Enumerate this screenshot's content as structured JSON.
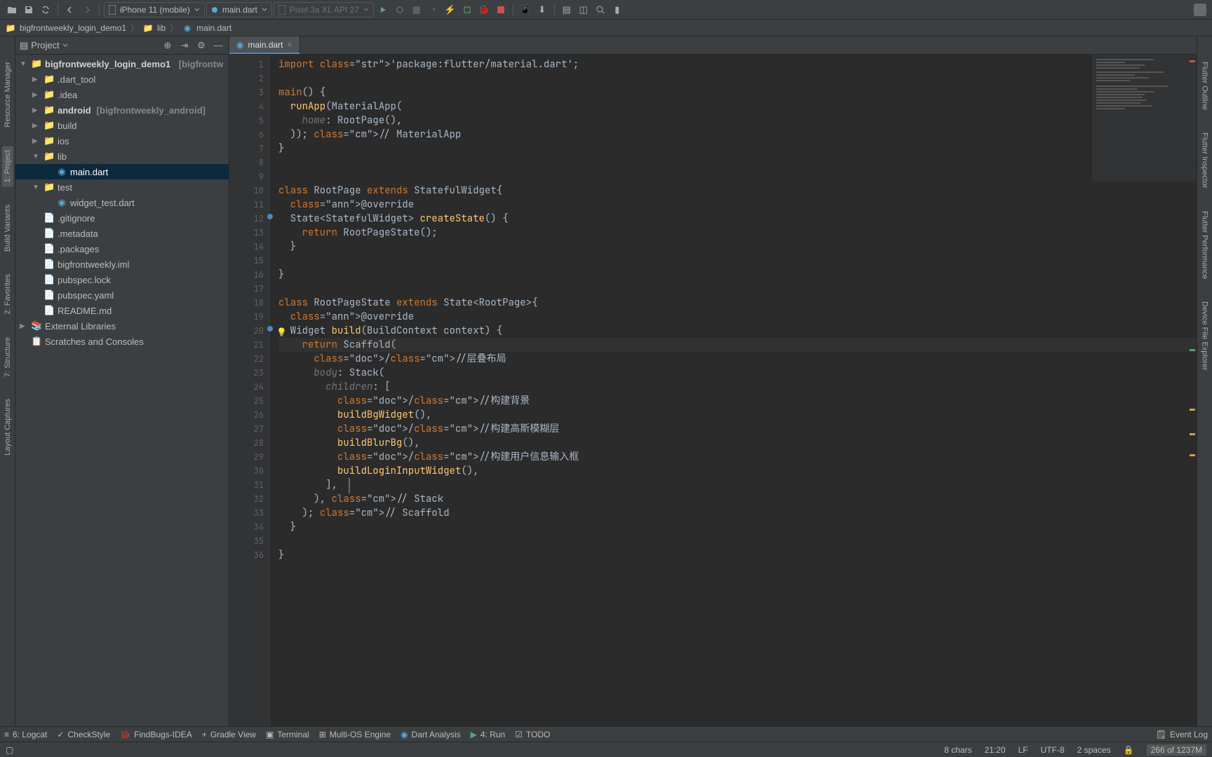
{
  "toolbar": {
    "device": "iPhone 11 (mobile)",
    "run_config": "main.dart",
    "emulator": "Pixel 3a XL API 27"
  },
  "breadcrumb": {
    "project": "bigfrontweekly_login_demo1",
    "folder": "lib",
    "file": "main.dart"
  },
  "project": {
    "header": "Project",
    "root": "bigfrontweekly_login_demo1",
    "root_suffix": "[bigfrontw",
    "items": [
      {
        "name": ".dart_tool",
        "type": "folder",
        "indent": 1
      },
      {
        "name": ".idea",
        "type": "folder",
        "indent": 1
      },
      {
        "name": "android",
        "type": "folder",
        "indent": 1,
        "suffix": "[bigfrontweekly_android]"
      },
      {
        "name": "build",
        "type": "folder",
        "indent": 1
      },
      {
        "name": "ios",
        "type": "folder",
        "indent": 1
      },
      {
        "name": "lib",
        "type": "folder",
        "indent": 1,
        "open": true
      },
      {
        "name": "main.dart",
        "type": "dart",
        "indent": 2,
        "selected": true
      },
      {
        "name": "test",
        "type": "folder",
        "indent": 1,
        "open": true
      },
      {
        "name": "widget_test.dart",
        "type": "dart",
        "indent": 2
      },
      {
        "name": ".gitignore",
        "type": "file",
        "indent": 1
      },
      {
        "name": ".metadata",
        "type": "file",
        "indent": 1
      },
      {
        "name": ".packages",
        "type": "file",
        "indent": 1
      },
      {
        "name": "bigfrontweekly.iml",
        "type": "file",
        "indent": 1
      },
      {
        "name": "pubspec.lock",
        "type": "file",
        "indent": 1
      },
      {
        "name": "pubspec.yaml",
        "type": "file",
        "indent": 1
      },
      {
        "name": "README.md",
        "type": "file",
        "indent": 1
      }
    ],
    "external": "External Libraries",
    "scratches": "Scratches and Consoles"
  },
  "tabs": [
    {
      "label": "main.dart",
      "active": true
    }
  ],
  "editor": {
    "open_file": "main.dart",
    "lines": [
      "import 'package:flutter/material.dart';",
      "",
      "main() {",
      "  runApp(MaterialApp(",
      "    home: RootPage(),",
      "  )); // MaterialApp",
      "}",
      "",
      "",
      "class RootPage extends StatefulWidget{",
      "  @override",
      "  State<StatefulWidget> createState() {",
      "    return RootPageState();",
      "  }",
      "",
      "}",
      "",
      "class RootPageState extends State<RootPage>{",
      "  @override",
      "  Widget build(BuildContext context) {",
      "    return Scaffold(",
      "      ///层叠布局",
      "      body: Stack(",
      "        children: [",
      "          ///构建背景",
      "          buildBgWidget(),",
      "          ///构建高斯模糊层",
      "          buildBlurBg(),",
      "          ///构建用户信息输入框",
      "          buildLoginInputWidget(),",
      "        ],",
      "      ), // Stack",
      "    ); // Scaffold",
      "  }",
      "",
      "}"
    ]
  },
  "left_tabs": {
    "resource": "Resource Manager",
    "project": "1: Project",
    "variants": "Build Variants",
    "favorites": "2: Favorites",
    "structure": "7: Structure",
    "captures": "Layout Captures"
  },
  "right_tabs": {
    "outline": "Flutter Outline",
    "inspector": "Flutter Inspector",
    "performance": "Flutter Performance",
    "device": "Device File Explorer"
  },
  "bottom": {
    "logcat": "6: Logcat",
    "checkstyle": "CheckStyle",
    "findbugs": "FindBugs-IDEA",
    "gradle": "Gradle View",
    "terminal": "Terminal",
    "multios": "Multi-OS Engine",
    "dart": "Dart Analysis",
    "run": "4: Run",
    "todo": "TODO",
    "eventlog": "Event Log"
  },
  "status": {
    "chars": "8 chars",
    "pos": "21:20",
    "lineend": "LF",
    "encoding": "UTF-8",
    "indent": "2 spaces",
    "mem": "266 of 1237M"
  }
}
